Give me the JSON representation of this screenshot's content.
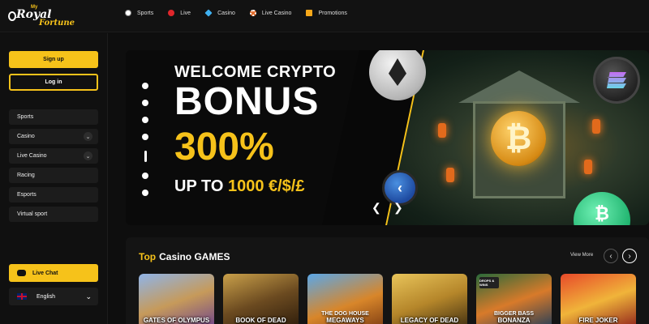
{
  "brand": {
    "my": "My",
    "royal": "Royal",
    "fortune": "Fortune"
  },
  "nav": [
    {
      "label": "Sports",
      "icon": "soccer-ball-icon",
      "color": "#ffffff"
    },
    {
      "label": "Live",
      "icon": "live-icon",
      "color": "#e0262b"
    },
    {
      "label": "Casino",
      "icon": "diamond-icon",
      "color": "#3fb0f0"
    },
    {
      "label": "Live Casino",
      "icon": "roulette-icon",
      "color": "#e06a2a"
    },
    {
      "label": "Promotions",
      "icon": "gift-icon",
      "color": "#f6a81a"
    }
  ],
  "sidebar": {
    "signup": "Sign up",
    "login": "Log in",
    "items": [
      {
        "label": "Sports",
        "has_chevron": false
      },
      {
        "label": "Casino",
        "has_chevron": true
      },
      {
        "label": "Live Casino",
        "has_chevron": true
      },
      {
        "label": "Racing",
        "has_chevron": false
      },
      {
        "label": "Esports",
        "has_chevron": false
      },
      {
        "label": "Virtual sport",
        "has_chevron": false
      }
    ],
    "live_chat": "Live Chat",
    "language": "English"
  },
  "banner": {
    "line1": "WELCOME CRYPTO",
    "line2": "BONUS",
    "line3": "300%",
    "line4_prefix": "UP TO ",
    "line4_amount": "1000 €/$/£",
    "slide_count": 6,
    "active_slide": 4
  },
  "top_games": {
    "title_highlight": "Top",
    "title_rest": "Casino GAMES",
    "view_more": "View More",
    "games": [
      {
        "name": "GATES OF OLYMPUS",
        "sub": "",
        "badge": ""
      },
      {
        "name": "BOOK OF DEAD",
        "sub": "",
        "badge": ""
      },
      {
        "name": "MEGAWAYS",
        "sub": "THE DOG HOUSE",
        "badge": ""
      },
      {
        "name": "LEGACY OF DEAD",
        "sub": "",
        "badge": ""
      },
      {
        "name": "BONANZA",
        "sub": "BIGGER BASS",
        "badge": "DROPS & WINS"
      },
      {
        "name": "FIRE JOKER",
        "sub": "",
        "badge": ""
      }
    ]
  },
  "colors": {
    "accent": "#f6c21a",
    "background": "#0e0e0e",
    "panel": "#1c1c1c"
  }
}
